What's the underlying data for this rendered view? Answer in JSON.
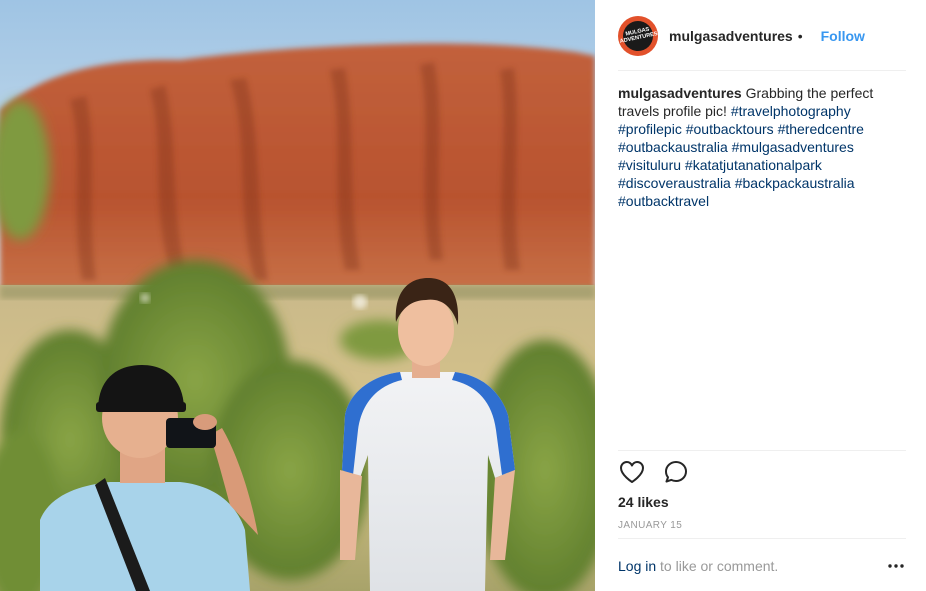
{
  "post": {
    "photo_alt": "Uluru backdrop, one man photographing another",
    "header": {
      "username": "mulgasadventures",
      "separator": "•",
      "follow_label": "Follow",
      "avatar_text": "MULGAS ADVENTURES"
    },
    "caption": {
      "username": "mulgasadventures",
      "text": "Grabbing the perfect travels profile pic!",
      "hashtags": [
        "#travelphotography",
        "#profilepic",
        "#outbacktours",
        "#theredcentre",
        "#outbackaustralia",
        "#mulgasadventures",
        "#visituluru",
        "#katatjutanationalpark",
        "#discoveraustralia",
        "#backpackaustralia",
        "#outbacktravel"
      ]
    },
    "actions": {
      "like_icon": "heart-icon",
      "comment_icon": "comment-icon"
    },
    "likes": "24 likes",
    "date": "JANUARY 15",
    "footer": {
      "login_label": "Log in",
      "login_suffix": "to like or comment.",
      "more_icon": "more-options-icon"
    },
    "colors": {
      "accent": "#3897f0",
      "hashtag": "#003569",
      "muted": "#999999",
      "divider": "#efefef"
    }
  }
}
